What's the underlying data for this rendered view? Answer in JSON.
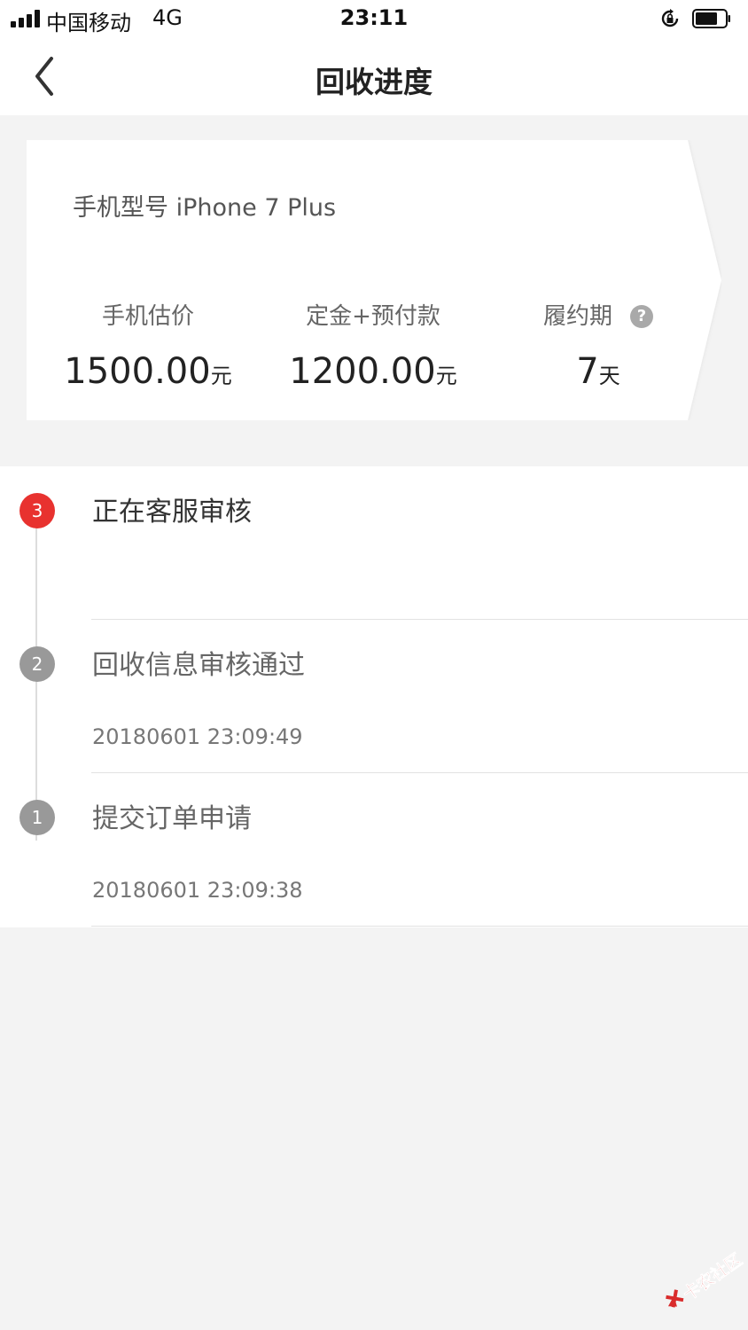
{
  "status_bar": {
    "carrier": "中国移动",
    "network": "4G",
    "time": "23:11"
  },
  "nav": {
    "title": "回收进度"
  },
  "card": {
    "model_label": "手机型号",
    "model_value": "iPhone 7 Plus",
    "stats": [
      {
        "label": "手机估价",
        "value": "1500.00",
        "unit": "元"
      },
      {
        "label": "定金+预付款",
        "value": "1200.00",
        "unit": "元"
      },
      {
        "label": "履约期",
        "value": "7",
        "unit": "天"
      }
    ],
    "help_glyph": "?"
  },
  "timeline": [
    {
      "step": "3",
      "title": "正在客服审核",
      "time": "",
      "state": "active"
    },
    {
      "step": "2",
      "title": "回收信息审核通过",
      "time": "20180601 23:09:49",
      "state": "done"
    },
    {
      "step": "1",
      "title": "提交订单申请",
      "time": "20180601 23:09:38",
      "state": "done"
    }
  ],
  "watermark": {
    "text": "卡农社区"
  },
  "colors": {
    "accent_red": "#e8322f",
    "step_gray": "#999999",
    "background": "#f3f3f3"
  }
}
